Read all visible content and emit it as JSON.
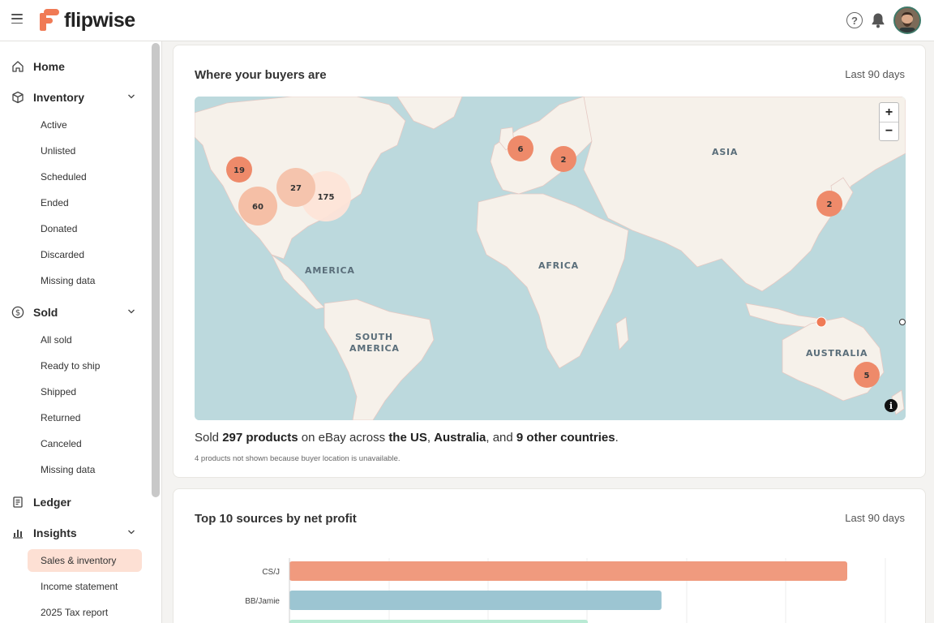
{
  "app": {
    "name": "flipwise"
  },
  "header": {
    "help_icon": "help-circle-icon",
    "bell_icon": "bell-icon"
  },
  "sidebar": {
    "home": "Home",
    "inventory": {
      "label": "Inventory",
      "items": [
        "Active",
        "Unlisted",
        "Scheduled",
        "Ended",
        "Donated",
        "Discarded",
        "Missing data"
      ]
    },
    "sold": {
      "label": "Sold",
      "items": [
        "All sold",
        "Ready to ship",
        "Shipped",
        "Returned",
        "Canceled",
        "Missing data"
      ]
    },
    "ledger": "Ledger",
    "insights": {
      "label": "Insights",
      "items": [
        "Sales & inventory",
        "Income statement",
        "2025 Tax report"
      ],
      "active": "Sales & inventory"
    }
  },
  "map_card": {
    "title": "Where your buyers are",
    "range": "Last 90 days",
    "region_labels": [
      "AMERICA",
      "SOUTH",
      "AMERICA",
      "AFRICA",
      "ASIA",
      "AUSTRALIA"
    ],
    "clusters": [
      {
        "count": "19",
        "region": "US West"
      },
      {
        "count": "60",
        "region": "US Southwest"
      },
      {
        "count": "27",
        "region": "US Central"
      },
      {
        "count": "175",
        "region": "US East"
      },
      {
        "count": "6",
        "region": "UK"
      },
      {
        "count": "2",
        "region": "Central Europe"
      },
      {
        "count": "2",
        "region": "Japan"
      },
      {
        "count": "5",
        "region": "Australia East"
      }
    ],
    "summary": {
      "p1": "Sold ",
      "products": "297 products",
      "p2": " on eBay across ",
      "us": "the US",
      "p3": ", ",
      "au": "Australia",
      "p4": ", and ",
      "others": "9 other countries",
      "p5": "."
    },
    "note": "4 products not shown because buyer location is unavailable.",
    "zoom_in": "+",
    "zoom_out": "−",
    "info": "i"
  },
  "sources_card": {
    "title": "Top 10 sources by net profit",
    "range": "Last 90 days"
  },
  "chart_data": {
    "type": "bar",
    "orientation": "horizontal",
    "title": "Top 10 sources by net profit",
    "categories": [
      "CS/J",
      "BB/Jamie",
      ""
    ],
    "values": [
      100,
      66.7,
      53.5
    ],
    "colors": [
      "#f09a7e",
      "#9cc5d2",
      "#b9ead4"
    ]
  },
  "colors": {
    "accent": "#f07a55",
    "active_bg": "#fde0d4",
    "water": "#bcd9dd",
    "land": "#f6f1ea"
  }
}
